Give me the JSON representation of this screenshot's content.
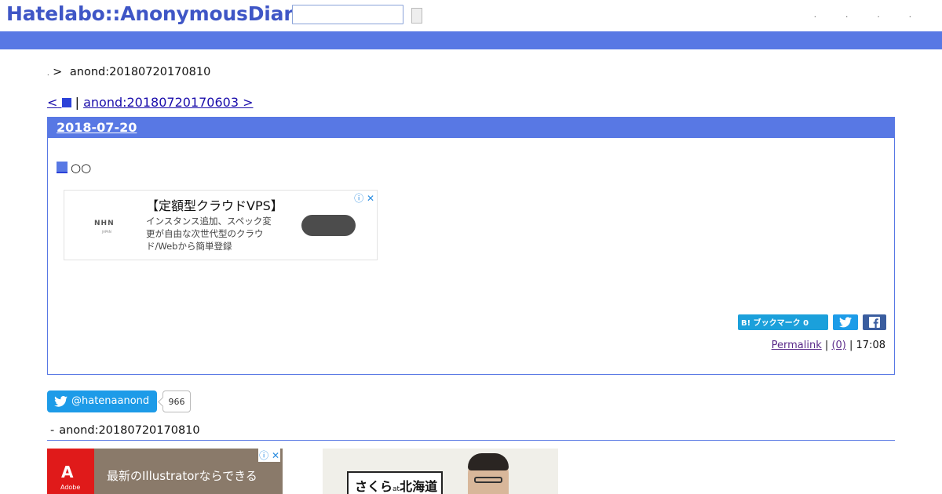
{
  "header": {
    "logo": "Hatelabo::AnonymousDiary",
    "search": {
      "value": "",
      "placeholder": ""
    },
    "dots": ". . . ."
  },
  "breadcrumb": {
    "dot": ".",
    "arrow": ">",
    "current": "anond:20180720170810"
  },
  "pager": {
    "prev_label": "<",
    "separator": "|",
    "next_label": "anond:20180720170603 >"
  },
  "entry": {
    "date": "2018-07-20",
    "title": "○○",
    "ad": {
      "brand": "NHN",
      "brand_sub": "JAPAN",
      "headline": "【定額型クラウドVPS】",
      "body": "インスタンス追加、スペック変更が自由な次世代型のクラウド/Webから簡単登録",
      "corner": "ⓘ ✕"
    },
    "share": {
      "hatena_label": "B! ブックマーク 0"
    },
    "footer": {
      "permalink": "Permalink",
      "sep1": "|",
      "comments": "(0)",
      "sep2": "|",
      "time": "17:08"
    },
    "colors": {
      "accent": "#5878e4",
      "link": "#1a0dab"
    }
  },
  "twitter": {
    "handle": "@hatenaanond",
    "count": "966"
  },
  "section": {
    "dash": "-",
    "title": "anond:20180720170810"
  },
  "bottom_ads": {
    "adobe": {
      "brand": "Adobe",
      "text": "最新のIllustratorならできる",
      "corner": "ⓘ ✕"
    },
    "sakura": {
      "sign_main": "さくら",
      "sign_small": "at",
      "sign_rest": "北海道"
    }
  }
}
